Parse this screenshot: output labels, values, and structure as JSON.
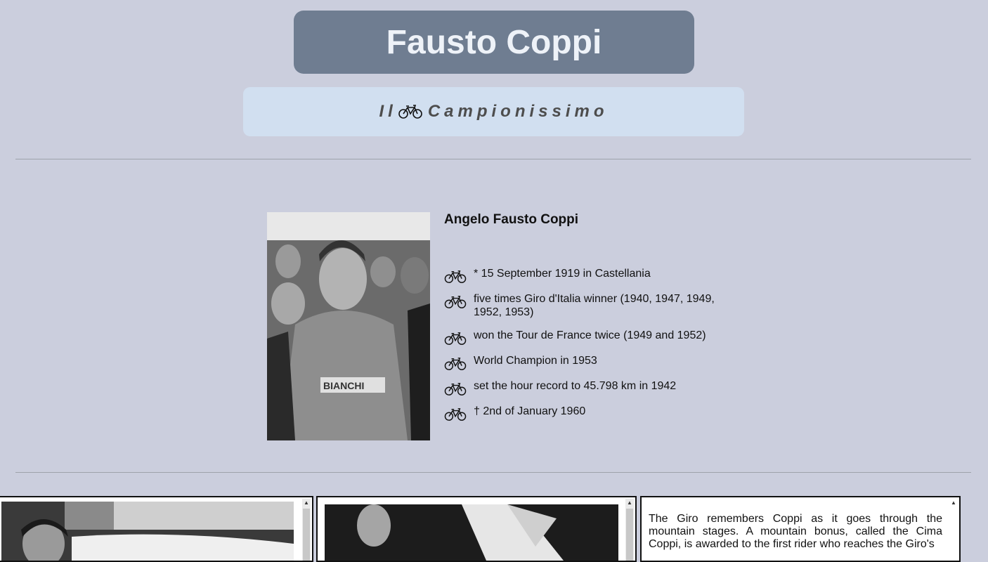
{
  "header": {
    "title": "Fausto Coppi",
    "subtitle_left": "Il",
    "subtitle_right": "Campionissimo",
    "subtitle_icon": "bicycle-icon"
  },
  "bio": {
    "name": "Angelo Fausto Coppi",
    "facts": [
      "* 15 September 1919 in Castellania",
      " five times Giro d'Italia winner (1940, 1947, 1949, 1952, 1953)",
      "won the Tour de France twice (1949 and 1952)",
      "World Champion in 1953",
      "set the hour record to 45.798 km in 1942",
      "† 2nd of January 1960"
    ],
    "bullet_icon": "bicycle-icon"
  },
  "panels": {
    "story_text": "The Giro remembers Coppi as it goes through the mountain stages. A mountain bonus, called the Cima Coppi, is awarded to the first rider who reaches the Giro's"
  },
  "colors": {
    "page_background": "#cbcedd",
    "title_box": "#6f7d91",
    "title_text": "#eef2f8",
    "subtitle_box": "#d1dff0",
    "subtitle_text": "#4d4d4d"
  }
}
